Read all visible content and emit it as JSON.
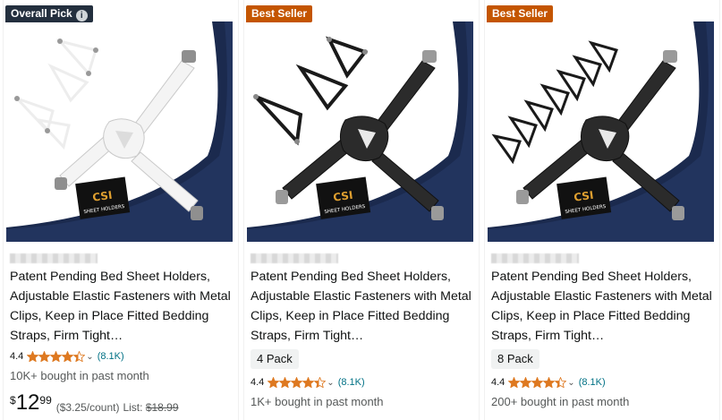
{
  "colors": {
    "star": "#de7921",
    "badge_dark": "#232f3e",
    "badge_orange": "#c45500",
    "link": "#007185",
    "sheet_navy": "#1b2a4e"
  },
  "products": [
    {
      "badge": "Overall Pick",
      "badge_icon": "info-icon",
      "title": "Patent Pending Bed Sheet Holders, Adjustable Elastic Fasteners with Metal Clips, Keep in Place Fitted Bedding Straps, Firm Tight…",
      "rating_value": "4.4",
      "rating_stars": 4.4,
      "rating_count": "(8.1K)",
      "bought": "10K+ bought in past month",
      "price_symbol": "$",
      "price_whole": "12",
      "price_fraction": "99",
      "unit_price": "($3.25/count)",
      "list_label": "List:",
      "list_price": "$18.99",
      "image_label_top": "CSI",
      "image_label_bottom": "SHEET HOLDERS"
    },
    {
      "badge": "Best Seller",
      "title": "Patent Pending Bed Sheet Holders, Adjustable Elastic Fasteners with Metal Clips, Keep in Place Fitted Bedding Straps, Firm Tight…",
      "pack": "4 Pack",
      "rating_value": "4.4",
      "rating_stars": 4.4,
      "rating_count": "(8.1K)",
      "bought": "1K+ bought in past month",
      "image_label_top": "CSI",
      "image_label_bottom": "SHEET HOLDERS"
    },
    {
      "badge": "Best Seller",
      "title": "Patent Pending Bed Sheet Holders, Adjustable Elastic Fasteners with Metal Clips, Keep in Place Fitted Bedding Straps, Firm Tight…",
      "pack": "8 Pack",
      "rating_value": "4.4",
      "rating_stars": 4.4,
      "rating_count": "(8.1K)",
      "bought": "200+ bought in past month",
      "image_label_top": "CSI",
      "image_label_bottom": "SHEET HOLDERS"
    }
  ]
}
